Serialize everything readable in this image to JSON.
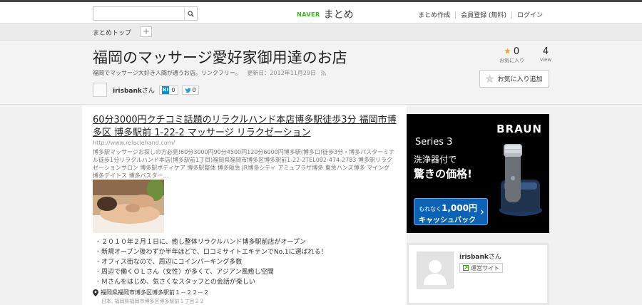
{
  "topbar": {
    "search": {
      "value": "",
      "placeholder": ""
    },
    "logo": {
      "naver": "NAVER",
      "matome": "まとめ"
    },
    "nav": [
      "まとめ作成",
      "会員登録 (無料)",
      "ログイン"
    ]
  },
  "breadcrumb": {
    "label": "まとめトップ",
    "add": "+"
  },
  "page": {
    "title": "福岡のマッサージ愛好家御用達のお店",
    "description": "福岡でマッサージ大好き人間が通うお店。リンクフリー。",
    "updated": "更新日：2012年11月29日",
    "author": {
      "name": "irisbank",
      "suffix": "さん"
    },
    "hatena": {
      "icon": "B!",
      "count": "0"
    },
    "twitter": {
      "count": "0"
    },
    "stats": {
      "favorites": {
        "count": "0",
        "label": "お気に入り"
      },
      "views": {
        "count": "4",
        "label": "view"
      }
    },
    "fav_button": "お気に入り追加"
  },
  "link": {
    "title": "60分3000円クチコミ話題のリラクルハンド本店博多駅徒歩3分 福岡市博多区 博多駅前 1-22-2 マッサージ リラクゼーション",
    "url": "http://www.relaclehand.com/",
    "snippet": "博多駅マッサージお探しの方必見!60分3000円90分4500円120分6000円博多駅(博多口)徒歩3分・博多バスターミナル徒歩1分リラクルハンド本店(博多駅前1丁目)福岡県福岡市博多区博多駅前1-22-2TEL092-474-2783 博多駅リラクゼーションサロン 博多駅ボディケア 博多駅整体 博多阪急 JR博多シティ アミュプラザ博多 東急ハンズ博多 マイング 博多デイトス 博多バスター…"
  },
  "bullets": [
    "２０１０年２月１日に、癒し整体リラクルハンド博多駅前店がオープン",
    "新規オープン後わずか半年ほどで、口コミサイトエキテンでNo.1に選ばれる！",
    "オフィス街なので、周辺にコインパーキング多数",
    "周辺で働くＯＬさん（女性）が多くて、アジアン風癒し空間",
    "Ｍさんをはじめ、気さくなスタッフとの会話が楽しい"
  ],
  "location": {
    "address": "福岡県福岡市博多区博多駅前１－２２－２",
    "sub": "日本, 福岡県福岡市博多区博多駅前１丁目２２"
  },
  "ad": {
    "brand": "BRAUN",
    "series": "Series 3",
    "line1": "洗浄器付で",
    "line2": "驚きの価格!",
    "cta_small": "もれなく",
    "cta_amount": "1,000円",
    "cta_text": "キャッシュバック"
  },
  "profile": {
    "name": "irisbank",
    "suffix": "さん",
    "badge": "運営サイト"
  },
  "colors": {
    "naver_green": "#1ec800",
    "star": "#f5a623",
    "ad_cta": "#0c63b5"
  }
}
